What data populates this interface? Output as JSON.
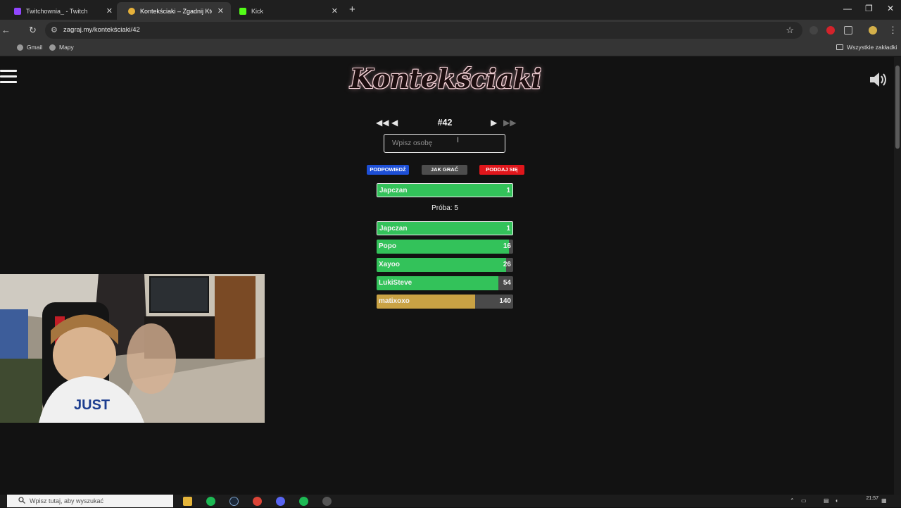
{
  "browser": {
    "tabs": [
      {
        "title": "Twitchownia_ - Twitch",
        "active": false
      },
      {
        "title": "Kontekściaki – Zgadnij Kto To?",
        "active": true
      },
      {
        "title": "Kick",
        "active": false
      }
    ],
    "url": "zagraj.my/kontekściaki/42",
    "bookmarks": [
      {
        "label": "Gmail"
      },
      {
        "label": "Mapy"
      }
    ],
    "all_bookmarks_label": "Wszystkie zakładki"
  },
  "game": {
    "logo": "Kontekściaki",
    "puzzle_number": "#42",
    "input_placeholder": "Wpisz osobę",
    "buttons": {
      "hint": "Podpowiedź",
      "how_to_play": "Jak grać",
      "give_up": "Poddaj się"
    },
    "last_guess": {
      "name": "Japczan",
      "rank": "1",
      "fill": 1.0,
      "color": "#33c25a"
    },
    "attempt_label": "Próba: 5",
    "guesses": [
      {
        "name": "Japczan",
        "rank": "1",
        "fill": 1.0,
        "color": "#33c25a"
      },
      {
        "name": "Popo",
        "rank": "16",
        "fill": 0.97,
        "color": "#33c25a"
      },
      {
        "name": "Xayoo",
        "rank": "26",
        "fill": 0.95,
        "color": "#33c25a"
      },
      {
        "name": "LukiSteve",
        "rank": "54",
        "fill": 0.89,
        "color": "#33c25a"
      },
      {
        "name": "matixoxo",
        "rank": "140",
        "fill": 0.72,
        "color": "#c9a244"
      }
    ]
  },
  "colors": {
    "hint_button": "#1d4fd6",
    "how_to_play_button": "#4d4d4d",
    "give_up_button": "#e0161b"
  },
  "taskbar": {
    "search_placeholder": "Wpisz tutaj, aby wyszukać",
    "time": "21:57"
  }
}
